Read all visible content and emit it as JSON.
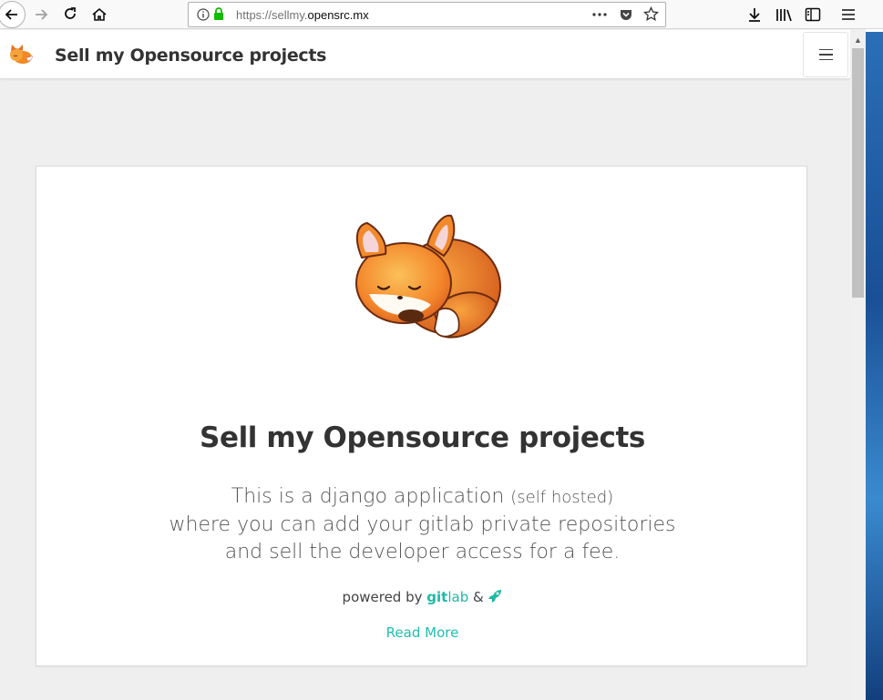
{
  "browser": {
    "url_prefix": "https://sellmy.",
    "url_domain": "opensrc.mx"
  },
  "site": {
    "brand_title": "Sell my Opensource projects"
  },
  "hero": {
    "title": "Sell my Opensource projects",
    "line1_main": "This is a django application ",
    "line1_small": "(self hosted)",
    "line2": "where you can add your gitlab private repositories",
    "line3": "and sell the developer access for a fee.",
    "powered_by": "powered by ",
    "gitlab_git": "git",
    "gitlab_lab": "lab",
    "amp": " & ",
    "read_more": "Read More"
  },
  "colors": {
    "accent": "#20bfae",
    "text": "#333333"
  },
  "icons": [
    "back-icon",
    "forward-icon",
    "reload-icon",
    "home-icon",
    "info-icon",
    "lock-icon",
    "more-icon",
    "pocket-icon",
    "star-icon",
    "download-icon",
    "library-icon",
    "sidebar-icon",
    "menu-icon",
    "fox-logo",
    "rocket-icon",
    "hamburger-icon"
  ]
}
